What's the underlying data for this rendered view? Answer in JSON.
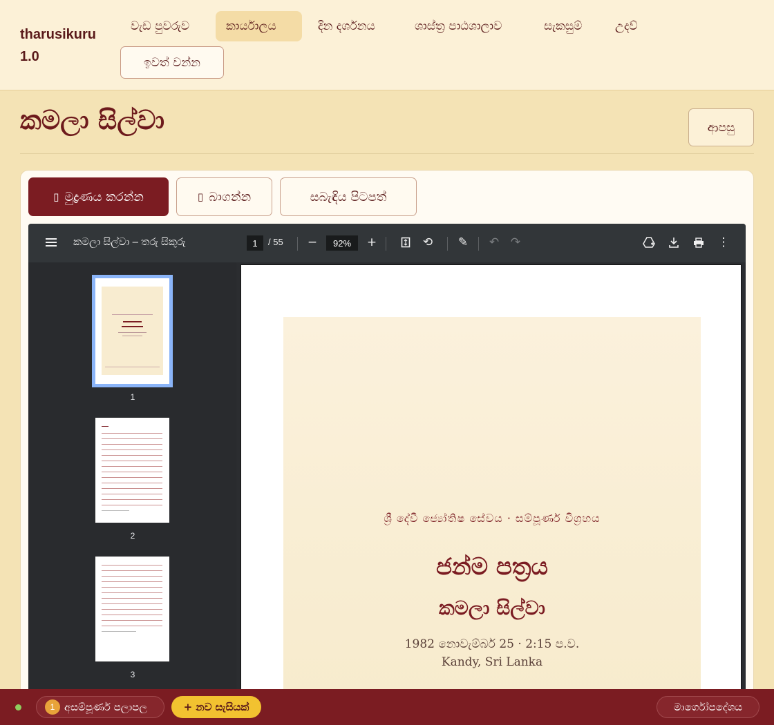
{
  "brand": {
    "line1": "tharusikuru",
    "line2": "1.0"
  },
  "nav": {
    "items": [
      {
        "label": "වැඩ පුවරුව"
      },
      {
        "label": "කාර්යාලය"
      },
      {
        "label": "දින දර්ශනය"
      },
      {
        "label": "ශාස්ත්‍ර පාඨශාලාව"
      },
      {
        "label": "සැකසුම්"
      },
      {
        "label": "උදව්"
      }
    ],
    "logout_label": "ඉවත් වන්න"
  },
  "page": {
    "title": "කමලා සිල්වා",
    "back_label": "ආපසු"
  },
  "actions": {
    "print_label": "මුද්‍රණය කරන්න",
    "print_icon": "printer-icon",
    "download_label": "බාගන්න",
    "download_icon": "download-icon",
    "related_label": "සබැඳිය පිටපත්"
  },
  "viewer": {
    "doc_title": "කමලා සිල්වා – තරු සිකුරු",
    "current_page": "1",
    "total_pages": "/ 55",
    "zoom": "92%",
    "thumbnails": [
      {
        "num": "1"
      },
      {
        "num": "2"
      },
      {
        "num": "3"
      }
    ],
    "page": {
      "header": "ශ්‍රී දේවී ජ්‍යෝතිෂ සේවය · සම්පූර්ණ විග්‍රහය",
      "title": "ජන්ම පත්‍රය",
      "name": "කමලා සිල්වා",
      "datetime": "1982 නොවැම්බර් 25 · 2:15 ප.ව.",
      "place": "Kandy, Sri Lanka"
    }
  },
  "bottombar": {
    "pending_count": "1",
    "pending_label": "අසම්පූර්ණ පලාපල",
    "new_session_label": "+ නව සැසියක්",
    "guide_label": "මාර්ගෝපදේශය"
  },
  "colors": {
    "accent": "#7b1c22",
    "background": "#f4e3b5",
    "cta": "#f2c230",
    "thumb_selected": "#8ab4f8"
  }
}
